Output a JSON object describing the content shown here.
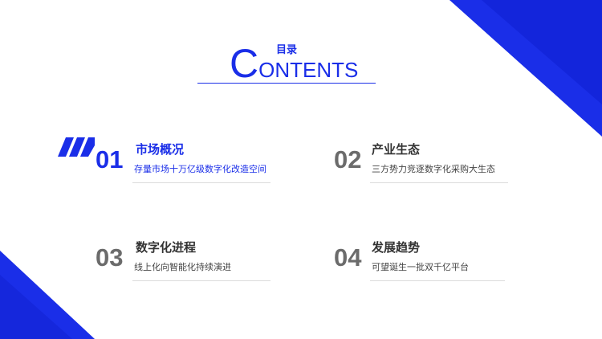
{
  "header": {
    "title_cn": "目录",
    "contents_first": "C",
    "contents_rest": "ONTENTS"
  },
  "items": [
    {
      "num": "01",
      "title": "市场概况",
      "desc": "存量市场十万亿级数字化改造空间"
    },
    {
      "num": "02",
      "title": "产业生态",
      "desc": "三方势力竞逐数字化采购大生态"
    },
    {
      "num": "03",
      "title": "数字化进程",
      "desc": "线上化向智能化持续演进"
    },
    {
      "num": "04",
      "title": "发展趋势",
      "desc": "可望诞生一批双千亿平台"
    }
  ],
  "colors": {
    "accent": "#1a2ee8",
    "accent_dark": "#0f1fd0",
    "number_gray": "#6b6b6b",
    "text": "#333333"
  }
}
